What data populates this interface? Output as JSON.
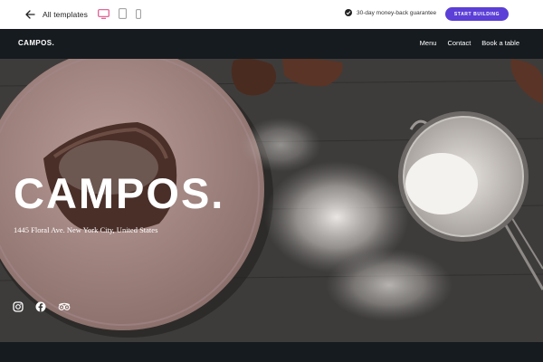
{
  "toolbar": {
    "back_label": "All templates",
    "devices": [
      "desktop-icon",
      "tablet-icon",
      "mobile-icon"
    ],
    "active_device": "desktop",
    "guarantee": "30-day money-back guarantee",
    "start_button": "START BUILDING",
    "accent_color": "#5b3fd6",
    "active_device_color": "#e0548c"
  },
  "site": {
    "logo": "CAMPOS.",
    "nav": [
      "Menu",
      "Contact",
      "Book a table"
    ]
  },
  "hero": {
    "title": "CAMPOS.",
    "address": "1445 Floral Ave. New York City, United States",
    "socials": [
      "instagram-icon",
      "facebook-icon",
      "tripadvisor-icon"
    ]
  }
}
